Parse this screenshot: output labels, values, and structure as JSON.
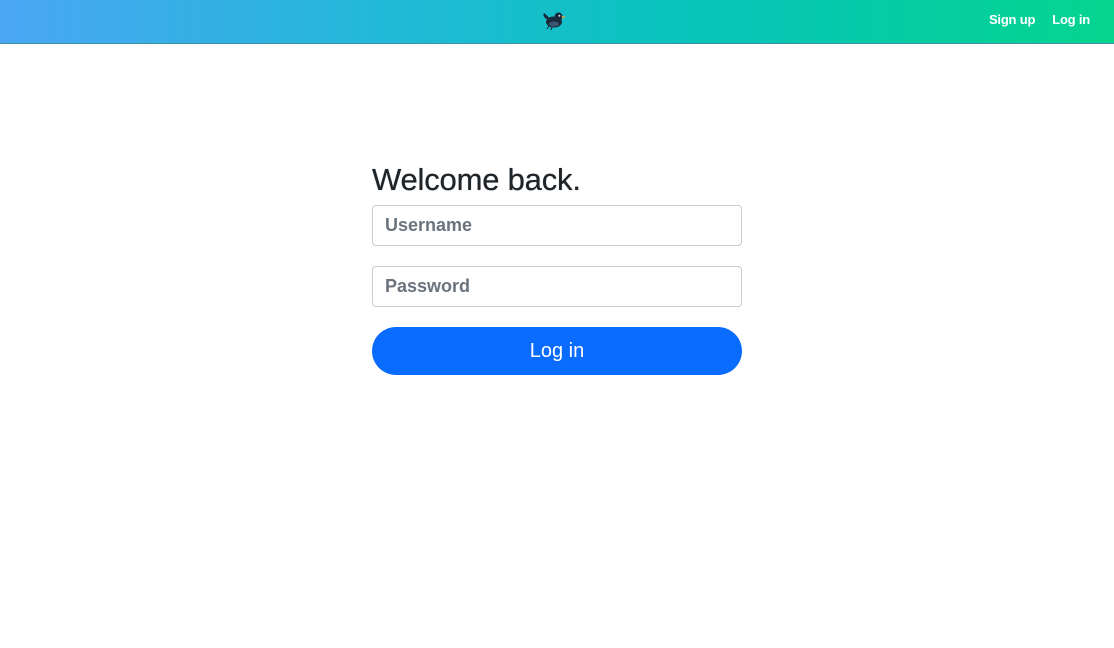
{
  "navbar": {
    "logo_icon": "bird-logo-icon",
    "links": [
      {
        "label": "Sign up"
      },
      {
        "label": "Log in"
      }
    ],
    "gradient_start": "#4aa6f3",
    "gradient_end": "#05d48e"
  },
  "login": {
    "heading": "Welcome back.",
    "username_placeholder": "Username",
    "username_value": "",
    "password_placeholder": "Password",
    "password_value": "",
    "submit_label": "Log in",
    "button_color": "#0a6bff"
  }
}
